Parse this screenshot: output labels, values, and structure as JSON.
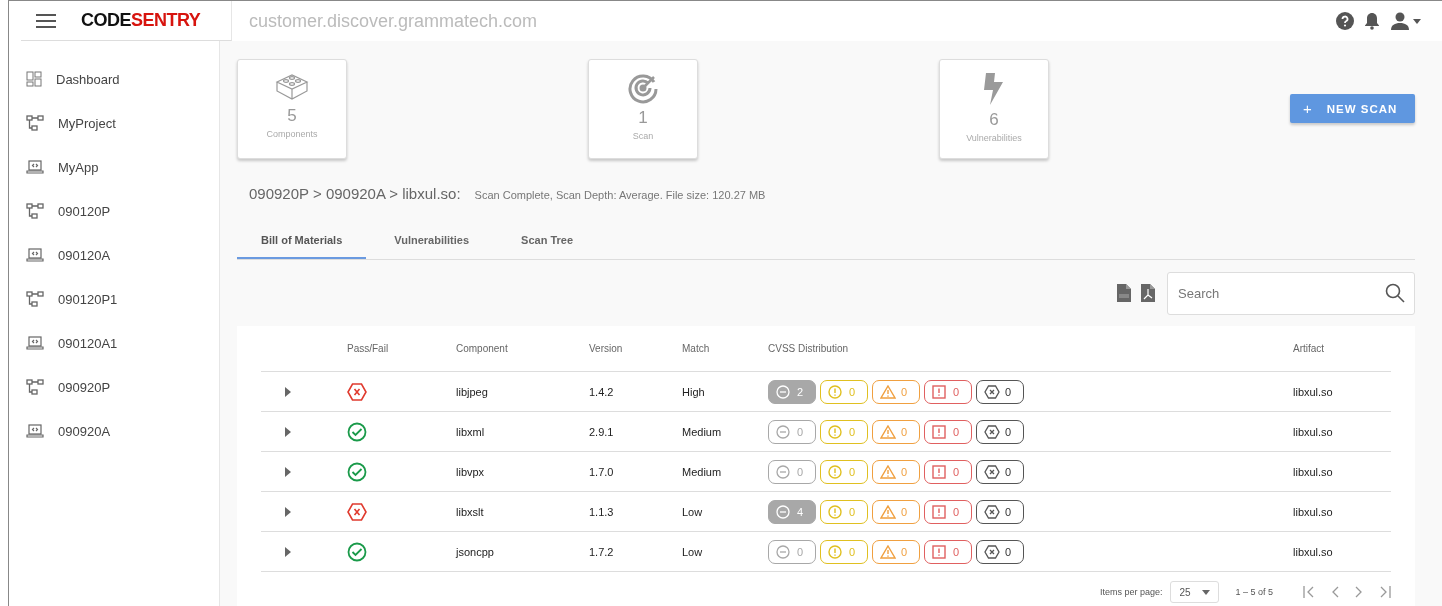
{
  "header": {
    "logo_dark": "CODE",
    "logo_red": "SENTRY",
    "host": "customer.discover.grammatech.com"
  },
  "sidebar": {
    "items": [
      {
        "label": "Dashboard",
        "kind": "dashboard"
      },
      {
        "label": "MyProject",
        "kind": "project"
      },
      {
        "label": "MyApp",
        "kind": "app"
      },
      {
        "label": "090120P",
        "kind": "project"
      },
      {
        "label": "090120A",
        "kind": "app"
      },
      {
        "label": "090120P1",
        "kind": "project"
      },
      {
        "label": "090120A1",
        "kind": "app"
      },
      {
        "label": "090920P",
        "kind": "project"
      },
      {
        "label": "090920A",
        "kind": "app"
      }
    ]
  },
  "stats": [
    {
      "kind": "components",
      "value": "5",
      "label": "Components"
    },
    {
      "kind": "scan",
      "value": "1",
      "label": "Scan"
    },
    {
      "kind": "vulnerabilities",
      "value": "6",
      "label": "Vulnerabilities"
    }
  ],
  "new_scan_button": {
    "icon": "+",
    "label": "NEW SCAN"
  },
  "breadcrumb": {
    "path": "090920P > 090920A > libxul.so:",
    "details": "Scan Complete, Scan Depth: Average. File size: 120.27 MB"
  },
  "tabs": [
    {
      "label": "Bill of Materials",
      "selected": true
    },
    {
      "label": "Vulnerabilities",
      "selected": false
    },
    {
      "label": "Scan Tree",
      "selected": false
    }
  ],
  "search": {
    "placeholder": "Search"
  },
  "table": {
    "columns": [
      "Pass/Fail",
      "Component",
      "Version",
      "Match",
      "CVSS Distribution",
      "Artifact"
    ],
    "rows": [
      {
        "expanded": false,
        "kind": "fail",
        "component": "libjpeg",
        "version": "1.4.2",
        "match": "High",
        "artifact": "libxul.so",
        "cvss": [
          {
            "kind": "none",
            "count": "2",
            "filled": true
          },
          {
            "kind": "low",
            "count": "0",
            "filled": false
          },
          {
            "kind": "medium",
            "count": "0",
            "filled": false
          },
          {
            "kind": "high",
            "count": "0",
            "filled": false
          },
          {
            "kind": "critical",
            "count": "0",
            "filled": false
          }
        ]
      },
      {
        "expanded": false,
        "kind": "pass",
        "component": "libxml",
        "version": "2.9.1",
        "match": "Medium",
        "artifact": "libxul.so",
        "cvss": [
          {
            "kind": "none",
            "count": "0",
            "filled": false
          },
          {
            "kind": "low",
            "count": "0",
            "filled": false
          },
          {
            "kind": "medium",
            "count": "0",
            "filled": false
          },
          {
            "kind": "high",
            "count": "0",
            "filled": false
          },
          {
            "kind": "critical",
            "count": "0",
            "filled": false
          }
        ]
      },
      {
        "expanded": false,
        "kind": "pass",
        "component": "libvpx",
        "version": "1.7.0",
        "match": "Medium",
        "artifact": "libxul.so",
        "cvss": [
          {
            "kind": "none",
            "count": "0",
            "filled": false
          },
          {
            "kind": "low",
            "count": "0",
            "filled": false
          },
          {
            "kind": "medium",
            "count": "0",
            "filled": false
          },
          {
            "kind": "high",
            "count": "0",
            "filled": false
          },
          {
            "kind": "critical",
            "count": "0",
            "filled": false
          }
        ]
      },
      {
        "expanded": false,
        "kind": "fail",
        "component": "libxslt",
        "version": "1.1.3",
        "match": "Low",
        "artifact": "libxul.so",
        "cvss": [
          {
            "kind": "none",
            "count": "4",
            "filled": true
          },
          {
            "kind": "low",
            "count": "0",
            "filled": false
          },
          {
            "kind": "medium",
            "count": "0",
            "filled": false
          },
          {
            "kind": "high",
            "count": "0",
            "filled": false
          },
          {
            "kind": "critical",
            "count": "0",
            "filled": false
          }
        ]
      },
      {
        "expanded": false,
        "kind": "pass",
        "component": "jsoncpp",
        "version": "1.7.2",
        "match": "Low",
        "artifact": "libxul.so",
        "cvss": [
          {
            "kind": "none",
            "count": "0",
            "filled": false
          },
          {
            "kind": "low",
            "count": "0",
            "filled": false
          },
          {
            "kind": "medium",
            "count": "0",
            "filled": false
          },
          {
            "kind": "high",
            "count": "0",
            "filled": false
          },
          {
            "kind": "critical",
            "count": "0",
            "filled": false
          }
        ]
      }
    ]
  },
  "pagination": {
    "items_label": "Items per page:",
    "page_size": "25",
    "range": "1 – 5 of 5"
  }
}
